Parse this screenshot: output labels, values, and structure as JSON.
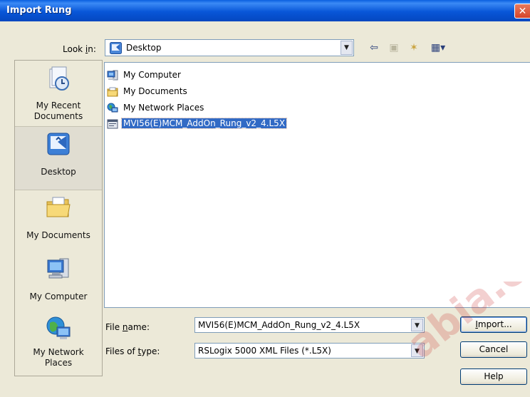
{
  "window": {
    "title": "Import Rung",
    "close_glyph": "✕"
  },
  "lookin": {
    "label_prefix": "Look ",
    "label_underlined": "i",
    "label_suffix": "n:",
    "value": "Desktop",
    "icon": "desktop-icon"
  },
  "toolbar": [
    {
      "name": "back-icon",
      "glyph": "⇦"
    },
    {
      "name": "up-folder-icon",
      "glyph": "▣"
    },
    {
      "name": "new-folder-icon",
      "glyph": "✶"
    },
    {
      "name": "view-menu-icon",
      "glyph": "▦▾"
    }
  ],
  "places": [
    {
      "label": "My Recent Documents",
      "line1": "My Recent",
      "line2": "Documents",
      "icon": "recent-documents-icon"
    },
    {
      "label": "Desktop",
      "icon": "desktop-icon",
      "selected": true
    },
    {
      "label": "My Documents",
      "icon": "my-documents-icon"
    },
    {
      "label": "My Computer",
      "icon": "my-computer-icon"
    },
    {
      "label": "My Network Places",
      "line1": "My Network",
      "line2": "Places",
      "icon": "network-places-icon"
    }
  ],
  "files": [
    {
      "name": "My Computer",
      "icon": "computer-icon"
    },
    {
      "name": "My Documents",
      "icon": "folder-icon"
    },
    {
      "name": "My Network Places",
      "icon": "network-icon"
    },
    {
      "name": "MVI56(E)MCM_AddOn_Rung_v2_4.L5X",
      "icon": "l5x-file-icon",
      "selected": true
    }
  ],
  "filename": {
    "label_prefix": "File ",
    "label_underlined": "n",
    "label_suffix": "ame:",
    "value": "MVI56(E)MCM_AddOn_Rung_v2_4.L5X"
  },
  "filetype": {
    "label_prefix": "Files of ",
    "label_underlined": "t",
    "label_suffix": "ype:",
    "value": "RSLogix 5000 XML Files (*.L5X)"
  },
  "buttons": {
    "import_u": "I",
    "import_rest": "mport...",
    "cancel": "Cancel",
    "help": "Help"
  },
  "watermark": "abia.c",
  "colors": {
    "title_bar": "#0a5fe0",
    "selection": "#316ac5",
    "dialog_bg": "#ece9d8"
  }
}
